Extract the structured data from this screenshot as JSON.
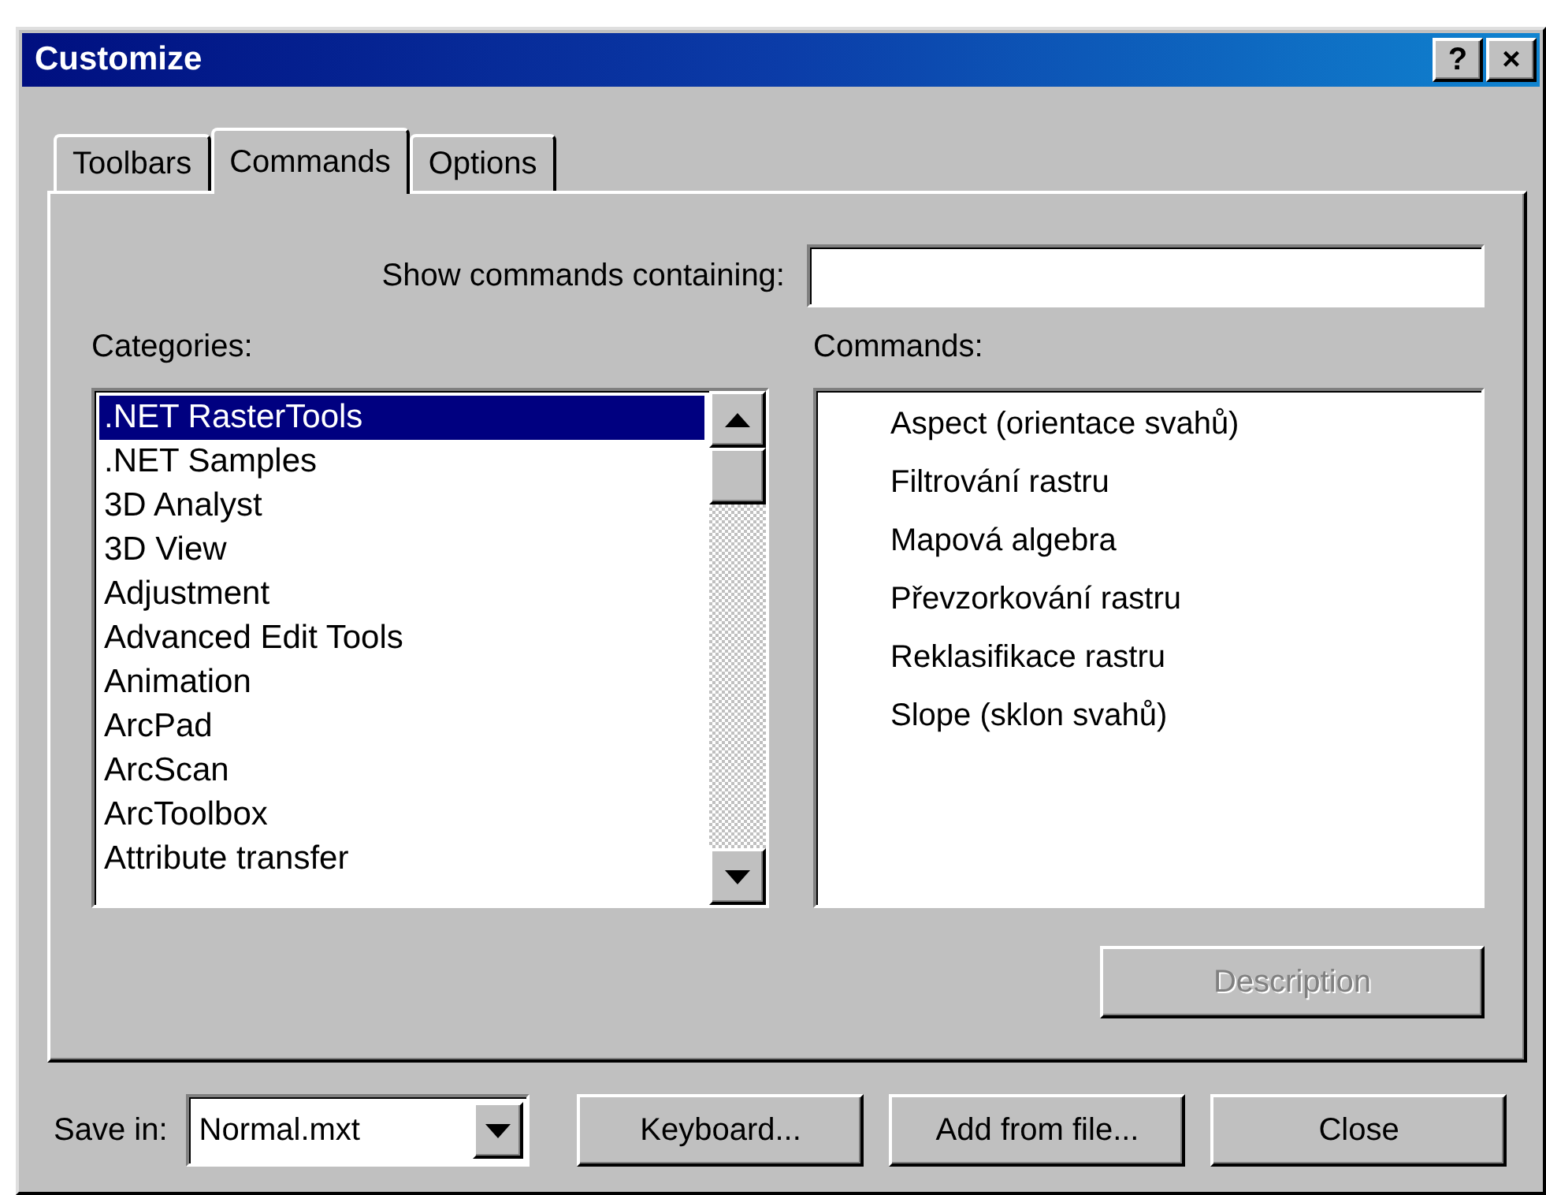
{
  "window": {
    "title": "Customize",
    "title_buttons": [
      "?",
      "×"
    ]
  },
  "tabs": [
    {
      "label": "Toolbars",
      "selected": false
    },
    {
      "label": "Commands",
      "selected": true
    },
    {
      "label": "Options",
      "selected": false
    }
  ],
  "search": {
    "label": "Show commands containing:"
  },
  "categories": {
    "label": "Categories:",
    "items": [
      {
        "label": ".NET RasterTools",
        "selected": true
      },
      {
        "label": ".NET Samples",
        "selected": false
      },
      {
        "label": "3D Analyst",
        "selected": false
      },
      {
        "label": "3D View",
        "selected": false
      },
      {
        "label": "Adjustment",
        "selected": false
      },
      {
        "label": "Advanced Edit Tools",
        "selected": false
      },
      {
        "label": "Animation",
        "selected": false
      },
      {
        "label": "ArcPad",
        "selected": false
      },
      {
        "label": "ArcScan",
        "selected": false
      },
      {
        "label": "ArcToolbox",
        "selected": false
      },
      {
        "label": "Attribute transfer",
        "selected": false
      }
    ]
  },
  "commands": {
    "label": "Commands:",
    "items": [
      "Aspect (orientace svahů)",
      "Filtrování rastru",
      "Mapová algebra",
      "Převzorkování rastru",
      "Reklasifikace rastru",
      "Slope (sklon svahů)"
    ]
  },
  "description_button": {
    "label": "Description",
    "disabled": true
  },
  "save_in": {
    "label": "Save in:",
    "value": "Normal.mxt"
  },
  "buttons": [
    "Keyboard...",
    "Add from file...",
    "Close"
  ]
}
